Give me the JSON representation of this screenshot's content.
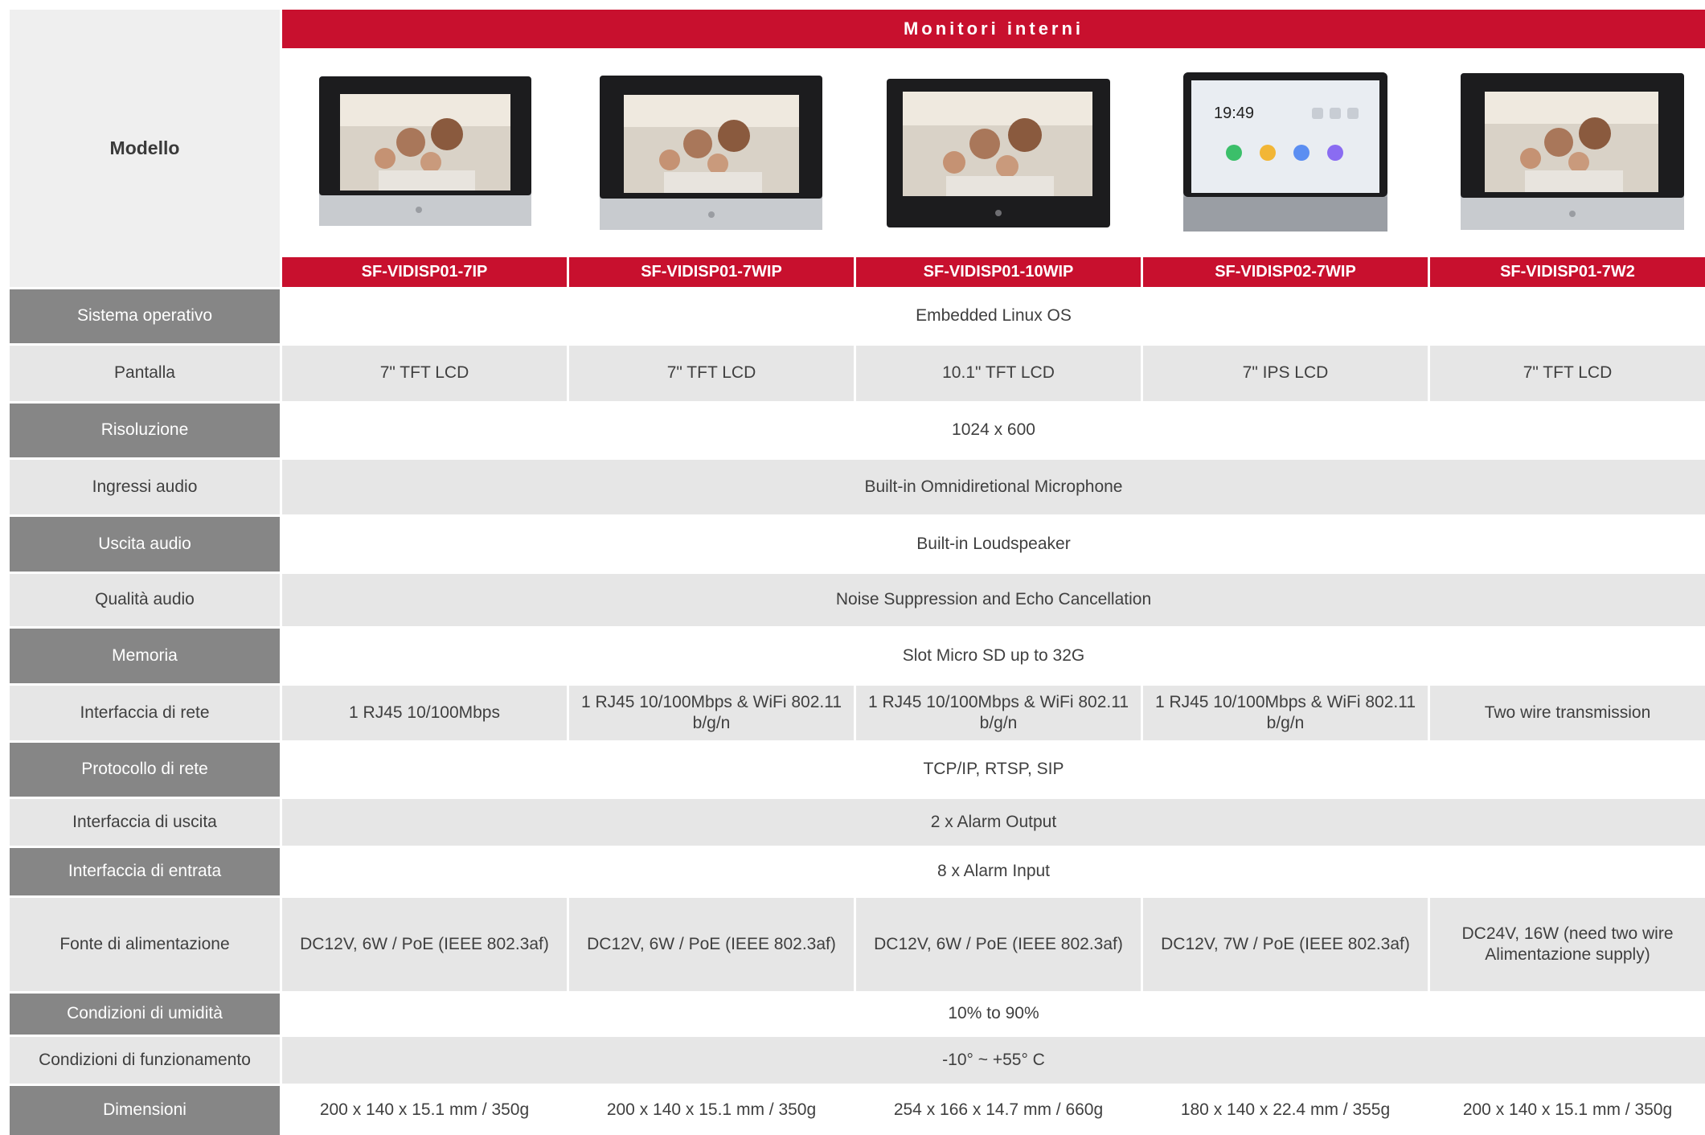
{
  "header": {
    "title": "Monitori interni",
    "model_label": "Modello"
  },
  "colors": {
    "accent": "#c8102e",
    "label_dark": "#868686",
    "row_gray": "#e6e6e6"
  },
  "models": [
    {
      "name": "SF-VIDISP01-7IP",
      "image": "monitor-family-photo"
    },
    {
      "name": "SF-VIDISP01-7WIP",
      "image": "monitor-family-photo"
    },
    {
      "name": "SF-VIDISP01-10WIP",
      "image": "monitor-family-photo"
    },
    {
      "name": "SF-VIDISP02-7WIP",
      "image": "monitor-home-screen",
      "screen_time": "19:49"
    },
    {
      "name": "SF-VIDISP01-7W2",
      "image": "monitor-family-photo"
    }
  ],
  "rows": [
    {
      "label": "Sistema operativo",
      "value": "Embedded Linux OS"
    },
    {
      "label": "Pantalla",
      "values": [
        "7\" TFT LCD",
        "7\" TFT LCD",
        "10.1\" TFT LCD",
        "7\" IPS LCD",
        "7\" TFT LCD"
      ]
    },
    {
      "label": "Risoluzione",
      "value": "1024 x 600"
    },
    {
      "label": "Ingressi audio",
      "value": "Built-in Omnidiretional Microphone"
    },
    {
      "label": "Uscita audio",
      "value": "Built-in Loudspeaker"
    },
    {
      "label": "Qualità audio",
      "value": "Noise Suppression and Echo Cancellation"
    },
    {
      "label": "Memoria",
      "value": "Slot Micro SD up to 32G"
    },
    {
      "label": "Interfaccia di rete",
      "values": [
        "1 RJ45 10/100Mbps",
        "1 RJ45 10/100Mbps & WiFi 802.11 b/g/n",
        "1 RJ45 10/100Mbps & WiFi 802.11 b/g/n",
        "1 RJ45 10/100Mbps & WiFi 802.11 b/g/n",
        "Two wire transmission"
      ]
    },
    {
      "label": "Protocollo di rete",
      "value": "TCP/IP, RTSP, SIP"
    },
    {
      "label": "Interfaccia di uscita",
      "value": "2 x Alarm Output"
    },
    {
      "label": "Interfaccia di entrata",
      "value": "8 x Alarm Input"
    },
    {
      "label": "Fonte di alimentazione",
      "values": [
        "DC12V, 6W / PoE (IEEE 802.3af)",
        "DC12V, 6W / PoE (IEEE 802.3af)",
        "DC12V, 6W / PoE (IEEE 802.3af)",
        "DC12V, 7W / PoE (IEEE 802.3af)",
        "DC24V, 16W (need two wire Alimentazione supply)"
      ]
    },
    {
      "label": "Condizioni di umidità",
      "value": "10% to 90%"
    },
    {
      "label": "Condizioni di funzionamento",
      "value": "-10° ~ +55° C"
    },
    {
      "label": "Dimensioni",
      "values": [
        "200 x 140 x 15.1 mm / 350g",
        "200 x 140 x 15.1 mm / 350g",
        "254 x 166 x 14.7 mm / 660g",
        "180 x 140 x 22.4 mm / 355g",
        "200 x 140 x 15.1 mm / 350g"
      ]
    }
  ]
}
